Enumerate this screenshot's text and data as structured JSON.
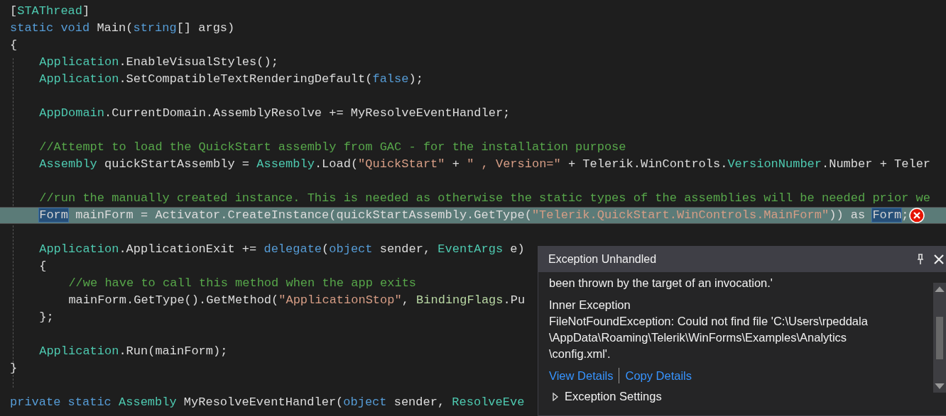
{
  "editor": {
    "lines": [
      {
        "current": false,
        "error": false,
        "tokens": [
          {
            "t": "[",
            "kind": "plain"
          },
          {
            "t": "STAThread",
            "kind": "type"
          },
          {
            "t": "]",
            "kind": "plain"
          }
        ]
      },
      {
        "current": false,
        "error": false,
        "tokens": [
          {
            "t": "static void ",
            "kind": "keyword"
          },
          {
            "t": "Main(",
            "kind": "plain"
          },
          {
            "t": "string",
            "kind": "keyword"
          },
          {
            "t": "[] args)",
            "kind": "plain"
          }
        ]
      },
      {
        "current": false,
        "error": false,
        "tokens": [
          {
            "t": "{",
            "kind": "plain"
          }
        ],
        "children": [
          {
            "current": false,
            "error": false,
            "tokens": [
              {
                "t": "Application",
                "kind": "type"
              },
              {
                "t": ".EnableVisualStyles();",
                "kind": "plain"
              }
            ]
          },
          {
            "current": false,
            "error": false,
            "tokens": [
              {
                "t": "Application",
                "kind": "type"
              },
              {
                "t": ".SetCompatibleTextRenderingDefault(",
                "kind": "plain"
              },
              {
                "t": "false",
                "kind": "keyword"
              },
              {
                "t": ");",
                "kind": "plain"
              }
            ]
          },
          {
            "current": false,
            "error": false
          },
          {
            "current": false,
            "error": false,
            "tokens": [
              {
                "t": "AppDomain",
                "kind": "type"
              },
              {
                "t": ".CurrentDomain.AssemblyResolve += MyResolveEventHandler;",
                "kind": "plain"
              }
            ]
          },
          {
            "current": false,
            "error": false
          },
          {
            "current": false,
            "error": false,
            "tokens": [
              {
                "t": "//Attempt to load the QuickStart assembly from GAC - for the installation purpose",
                "kind": "comment"
              }
            ]
          },
          {
            "current": false,
            "error": false,
            "tokens": [
              {
                "t": "Assembly",
                "kind": "type"
              },
              {
                "t": " quickStartAssembly = ",
                "kind": "plain"
              },
              {
                "t": "Assembly",
                "kind": "type"
              },
              {
                "t": ".Load(",
                "kind": "plain"
              },
              {
                "t": "\"QuickStart\"",
                "kind": "string"
              },
              {
                "t": " + ",
                "kind": "plain"
              },
              {
                "t": "\" , Version=\"",
                "kind": "string"
              },
              {
                "t": " + Telerik.WinControls.",
                "kind": "plain"
              },
              {
                "t": "VersionNumber",
                "kind": "type"
              },
              {
                "t": ".Number + Teler",
                "kind": "plain"
              }
            ]
          },
          {
            "current": false,
            "error": false
          },
          {
            "current": false,
            "error": false,
            "tokens": [
              {
                "t": "//run the manually created instance. This is needed as otherwise the static types of the assemblies will be needed prior we",
                "kind": "comment"
              }
            ]
          },
          {
            "current": true,
            "error": true,
            "tokens": [
              {
                "t": "Form",
                "kind": "reference"
              },
              {
                "t": " mainForm = Activator.CreateInstance(quickStartAssembly.GetType(",
                "kind": "plain"
              },
              {
                "t": "\"Telerik.QuickStart.WinControls.MainForm\"",
                "kind": "string"
              },
              {
                "t": ")) as ",
                "kind": "plain"
              },
              {
                "t": "Form",
                "kind": "reference"
              },
              {
                "t": ";",
                "kind": "plain"
              }
            ]
          },
          {
            "current": false,
            "error": false
          },
          {
            "current": false,
            "error": false,
            "tokens": [
              {
                "t": "Application",
                "kind": "type"
              },
              {
                "t": ".ApplicationExit += ",
                "kind": "plain"
              },
              {
                "t": "delegate",
                "kind": "keyword"
              },
              {
                "t": "(",
                "kind": "plain"
              },
              {
                "t": "object",
                "kind": "keyword"
              },
              {
                "t": " sender, ",
                "kind": "plain"
              },
              {
                "t": "EventArgs",
                "kind": "type"
              },
              {
                "t": " e)",
                "kind": "plain"
              }
            ]
          },
          {
            "current": false,
            "error": false,
            "tokens": [
              {
                "t": "{",
                "kind": "plain"
              }
            ],
            "children": [
              {
                "current": false,
                "error": false,
                "tokens": [
                  {
                    "t": "//we have to call this method when the app exits",
                    "kind": "comment"
                  }
                ]
              },
              {
                "current": false,
                "error": false,
                "tokens": [
                  {
                    "t": "mainForm.GetType().GetMethod(",
                    "kind": "plain"
                  },
                  {
                    "t": "\"ApplicationStop\"",
                    "kind": "string"
                  },
                  {
                    "t": ", ",
                    "kind": "plain"
                  },
                  {
                    "t": "BindingFlags",
                    "kind": "enum"
                  },
                  {
                    "t": ".Pu",
                    "kind": "plain"
                  }
                ]
              }
            ]
          },
          {
            "current": false,
            "error": false,
            "tokens": [
              {
                "t": "};",
                "kind": "plain"
              }
            ]
          },
          {
            "current": false,
            "error": false
          },
          {
            "current": false,
            "error": false,
            "tokens": [
              {
                "t": "Application",
                "kind": "type"
              },
              {
                "t": ".Run(mainForm);",
                "kind": "plain"
              }
            ]
          }
        ]
      },
      {
        "current": false,
        "error": false,
        "tokens": [
          {
            "t": "}",
            "kind": "plain"
          }
        ]
      },
      {
        "current": false,
        "error": false
      },
      {
        "current": false,
        "error": false,
        "tokens": [
          {
            "t": "private static ",
            "kind": "keyword"
          },
          {
            "t": "Assembly",
            "kind": "type"
          },
          {
            "t": " MyResolveEventHandler(",
            "kind": "plain"
          },
          {
            "t": "object",
            "kind": "keyword"
          },
          {
            "t": " sender, ",
            "kind": "plain"
          },
          {
            "t": "ResolveEve",
            "kind": "type"
          }
        ]
      }
    ]
  },
  "exception_popup": {
    "title": "Exception Unhandled",
    "message_tail": "been thrown by the target of an invocation.'",
    "inner_exception_heading": "Inner Exception",
    "inner_exception_message": "FileNotFoundException: Could not find file 'C:\\Users\\rpeddala \\AppData\\Roaming\\Telerik\\WinForms\\Examples\\Analytics \\config.xml'.",
    "links": [
      "View Details",
      "Copy Details"
    ],
    "settings": {
      "label": "Exception Settings",
      "expanded": false
    }
  }
}
